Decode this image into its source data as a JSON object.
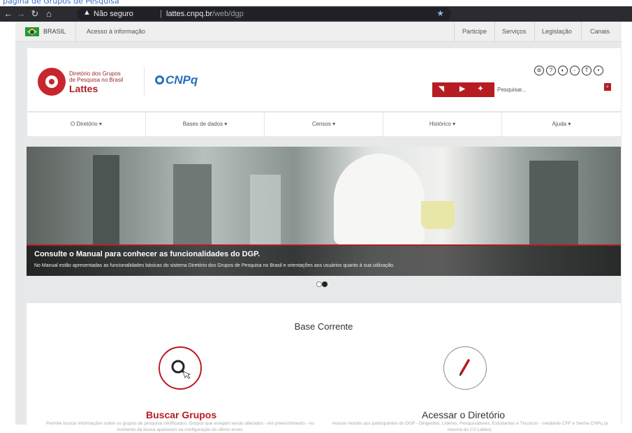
{
  "browser": {
    "top_cut_text": "página de Grupos de Pesquisa",
    "security_label": "Não seguro",
    "url_host": "lattes.cnpq.br",
    "url_path": "/web/dgp"
  },
  "govbar": {
    "country": "BRASIL",
    "access_info": "Acesso à informação",
    "links": [
      "Participe",
      "Serviços",
      "Legislação",
      "Canais"
    ]
  },
  "header": {
    "logo_line1": "Diretório dos Grupos",
    "logo_line2": "de Pesquisa no Brasil",
    "logo_line3": "Lattes",
    "cnpq": "CNPq",
    "search_placeholder": "Pesquisar..."
  },
  "menu": [
    "O Diretório ▾",
    "Bases de dados ▾",
    "Censos ▾",
    "Histórico ▾",
    "Ajuda ▾"
  ],
  "hero": {
    "title": "Consulte o Manual para conhecer as funcionalidades do DGP.",
    "description": "No Manual estão apresentadas as funcionalidades básicas do sistema Diretório dos Grupos de Pesquisa no Brasil e orientações aos usuários quanto à sua utilização."
  },
  "content": {
    "heading": "Base Corrente",
    "cards": [
      {
        "title": "Buscar Grupos",
        "description": "Permite buscar informações sobre os grupos de pesquisa certificados. Grupos que estejam sendo alterados - em preenchimento - no momento da busca aparecem na configuração do último envio.",
        "accent": "#b61c22"
      },
      {
        "title": "Acessar o Diretório",
        "description": "Acesso restrito aos participantes do DGP - Dirigentes, Líderes, Pesquisadores, Estudantes e Técnicos - mediante CPF e Senha CNPq (a mesma do CV Lattes).",
        "accent": "#555555"
      }
    ]
  },
  "colors": {
    "brand_red": "#b61c22",
    "cnpq_blue": "#2a6ebb"
  }
}
